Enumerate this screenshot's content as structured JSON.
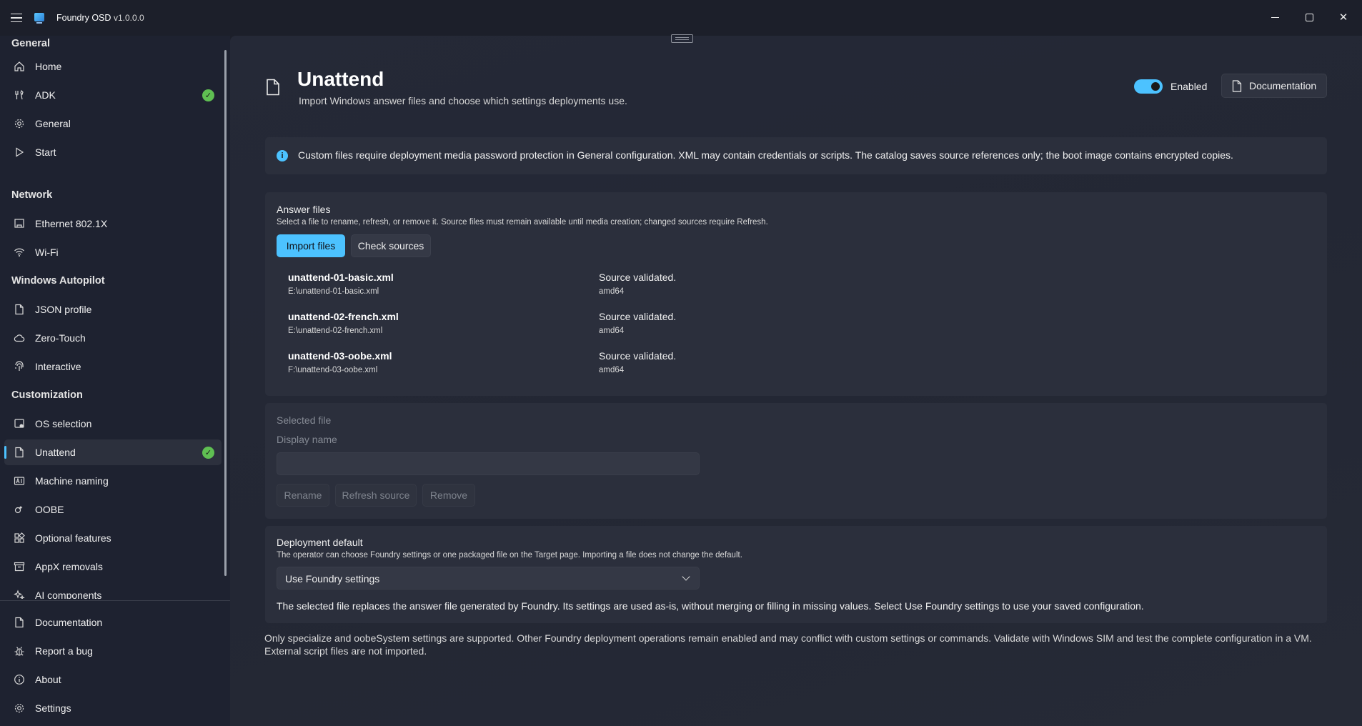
{
  "window": {
    "title": "Foundry OSD",
    "version": "v1.0.0.0"
  },
  "sidebar": {
    "sections": [
      {
        "header": "General"
      },
      {
        "header": "Network"
      },
      {
        "header": "Windows Autopilot"
      },
      {
        "header": "Customization"
      }
    ],
    "items": [
      {
        "label": "Home",
        "icon": "home-icon"
      },
      {
        "label": "ADK",
        "icon": "tools-icon",
        "status": "complete"
      },
      {
        "label": "General",
        "icon": "gear-icon"
      },
      {
        "label": "Start",
        "icon": "play-icon"
      },
      {
        "label": "Ethernet 802.1X",
        "icon": "ethernet-icon"
      },
      {
        "label": "Wi-Fi",
        "icon": "wifi-icon"
      },
      {
        "label": "JSON profile",
        "icon": "document-icon"
      },
      {
        "label": "Zero-Touch",
        "icon": "cloud-icon"
      },
      {
        "label": "Interactive",
        "icon": "fingerprint-icon"
      },
      {
        "label": "OS selection",
        "icon": "os-icon"
      },
      {
        "label": "Unattend",
        "icon": "document-icon",
        "status": "complete",
        "selected": true
      },
      {
        "label": "Machine naming",
        "icon": "naming-icon"
      },
      {
        "label": "OOBE",
        "icon": "oobe-icon"
      },
      {
        "label": "Optional features",
        "icon": "grid-icon"
      },
      {
        "label": "AppX removals",
        "icon": "archive-icon"
      },
      {
        "label": "AI components",
        "icon": "sparkle-icon"
      }
    ],
    "footer_items": [
      {
        "label": "Documentation",
        "icon": "document-icon"
      },
      {
        "label": "Report a bug",
        "icon": "bug-icon"
      },
      {
        "label": "About",
        "icon": "info-icon"
      },
      {
        "label": "Settings",
        "icon": "gear-icon"
      }
    ]
  },
  "page": {
    "title": "Unattend",
    "subtitle": "Import Windows answer files and choose which settings deployments use.",
    "toggle_label": "Enabled",
    "toggle_on": true,
    "documentation_label": "Documentation"
  },
  "info_bar": {
    "text": "Custom files require deployment media password protection in General configuration. XML may contain credentials or scripts. The catalog saves source references only; the boot image contains encrypted copies."
  },
  "answer_files": {
    "title": "Answer files",
    "description": "Select a file to rename, refresh, or remove it. Source files must remain available until media creation; changed sources require Refresh.",
    "import_label": "Import files",
    "check_label": "Check sources",
    "files": [
      {
        "name": "unattend-01-basic.xml",
        "path": "E:\\unattend-01-basic.xml",
        "status": "Source validated.",
        "arch": "amd64"
      },
      {
        "name": "unattend-02-french.xml",
        "path": "E:\\unattend-02-french.xml",
        "status": "Source validated.",
        "arch": "amd64"
      },
      {
        "name": "unattend-03-oobe.xml",
        "path": "F:\\unattend-03-oobe.xml",
        "status": "Source validated.",
        "arch": "amd64"
      }
    ]
  },
  "selected_file": {
    "title": "Selected file",
    "display_name_label": "Display name",
    "display_name_value": "",
    "rename_label": "Rename",
    "refresh_label": "Refresh source",
    "remove_label": "Remove"
  },
  "deployment_default": {
    "title": "Deployment default",
    "description": "The operator can choose Foundry settings or one packaged file on the Target page. Importing a file does not change the default.",
    "selected": "Use Foundry settings",
    "note": "The selected file replaces the answer file generated by Foundry. Its settings are used as-is, without merging or filling in missing values. Select Use Foundry settings to use your saved configuration."
  },
  "footer_note": "Only specialize and oobeSystem settings are supported. Other Foundry deployment operations remain enabled and may conflict with custom settings or commands. Validate with Windows SIM and test the complete configuration in a VM. External script files are not imported.",
  "colors": {
    "accent": "#4cc2ff",
    "success": "#5fbf52",
    "background": "#1c1f2a",
    "card": "#2b2f3c"
  }
}
